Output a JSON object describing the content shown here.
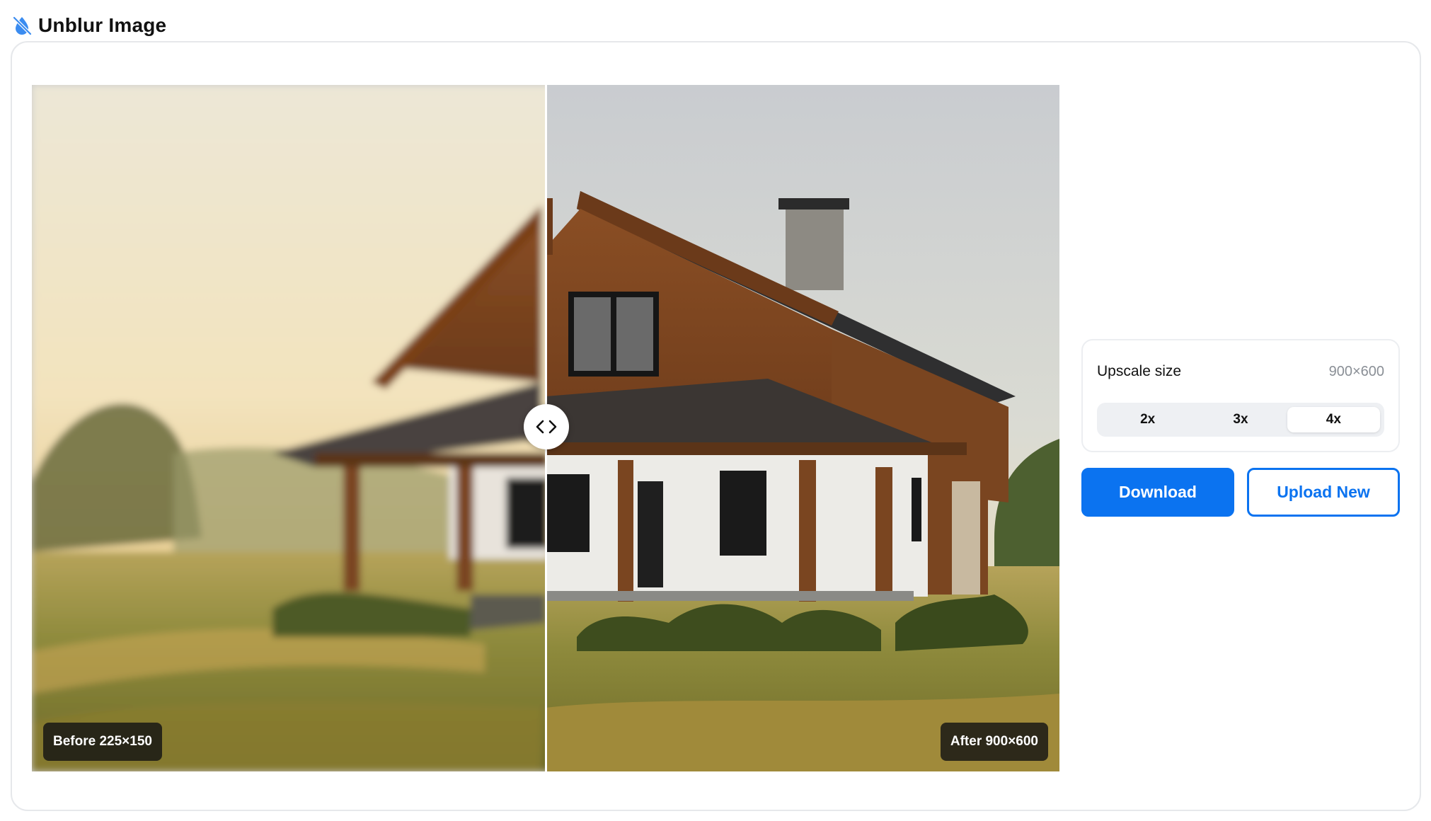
{
  "header": {
    "title": "Unblur Image",
    "icon": "droplet-slash-icon"
  },
  "compare": {
    "before_label": "Before 225×150",
    "after_label": "After 900×600",
    "handle_icon": "chevrons-left-right-icon",
    "divider_position": 0.5
  },
  "upscale": {
    "label": "Upscale size",
    "value": "900×600",
    "options": [
      "2x",
      "3x",
      "4x"
    ],
    "selected": "4x"
  },
  "actions": {
    "download_label": "Download",
    "upload_label": "Upload New"
  },
  "colors": {
    "accent": "#0b73f0",
    "icon": "#3b8cf0"
  }
}
